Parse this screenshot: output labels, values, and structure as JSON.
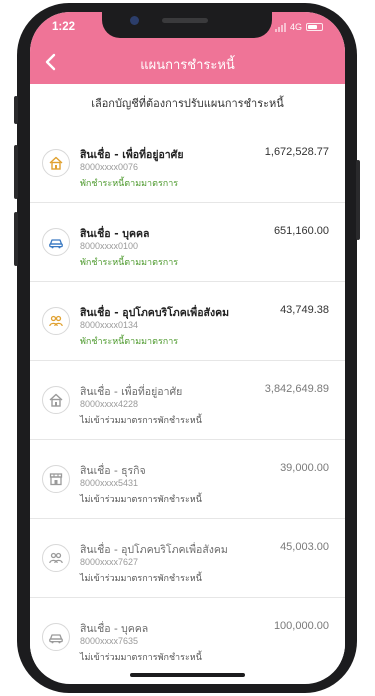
{
  "status_bar": {
    "time": "1:22",
    "network": "4G"
  },
  "header": {
    "title": "แผนการชำระหนี้"
  },
  "subtitle": "เลือกบัญชีที่ต้องการปรับแผนการชำระหนี้",
  "colors": {
    "header": "#ef7497",
    "eligible_note": "#4e9a2e"
  },
  "accounts": [
    {
      "name": "สินเชื่อ - เพื่อที่อยู่อาศัย",
      "amount": "1,672,528.77",
      "account": "8000xxxx0076",
      "note": "พักชำระหนี้ตามมาตรการ",
      "icon": "house-icon",
      "eligible": true
    },
    {
      "name": "สินเชื่อ - บุคคล",
      "amount": "651,160.00",
      "account": "8000xxxx0100",
      "note": "พักชำระหนี้ตามมาตรการ",
      "icon": "car-icon",
      "eligible": true
    },
    {
      "name": "สินเชื่อ - อุปโภคบริโภคเพื่อสังคม",
      "amount": "43,749.38",
      "account": "8000xxxx0134",
      "note": "พักชำระหนี้ตามมาตรการ",
      "icon": "people-icon",
      "eligible": true
    },
    {
      "name": "สินเชื่อ - เพื่อที่อยู่อาศัย",
      "amount": "3,842,649.89",
      "account": "8000xxxx4228",
      "note": "ไม่เข้าร่วมมาตรการพักชำระหนี้",
      "icon": "house-icon",
      "eligible": false
    },
    {
      "name": "สินเชื่อ - ธุรกิจ",
      "amount": "39,000.00",
      "account": "8000xxxx5431",
      "note": "ไม่เข้าร่วมมาตรการพักชำระหนี้",
      "icon": "shop-icon",
      "eligible": false
    },
    {
      "name": "สินเชื่อ - อุปโภคบริโภคเพื่อสังคม",
      "amount": "45,003.00",
      "account": "8000xxxx7627",
      "note": "ไม่เข้าร่วมมาตรการพักชำระหนี้",
      "icon": "people-icon",
      "eligible": false
    },
    {
      "name": "สินเชื่อ - บุคคล",
      "amount": "100,000.00",
      "account": "8000xxxx7635",
      "note": "ไม่เข้าร่วมมาตรการพักชำระหนี้",
      "icon": "car-icon",
      "eligible": false
    }
  ]
}
